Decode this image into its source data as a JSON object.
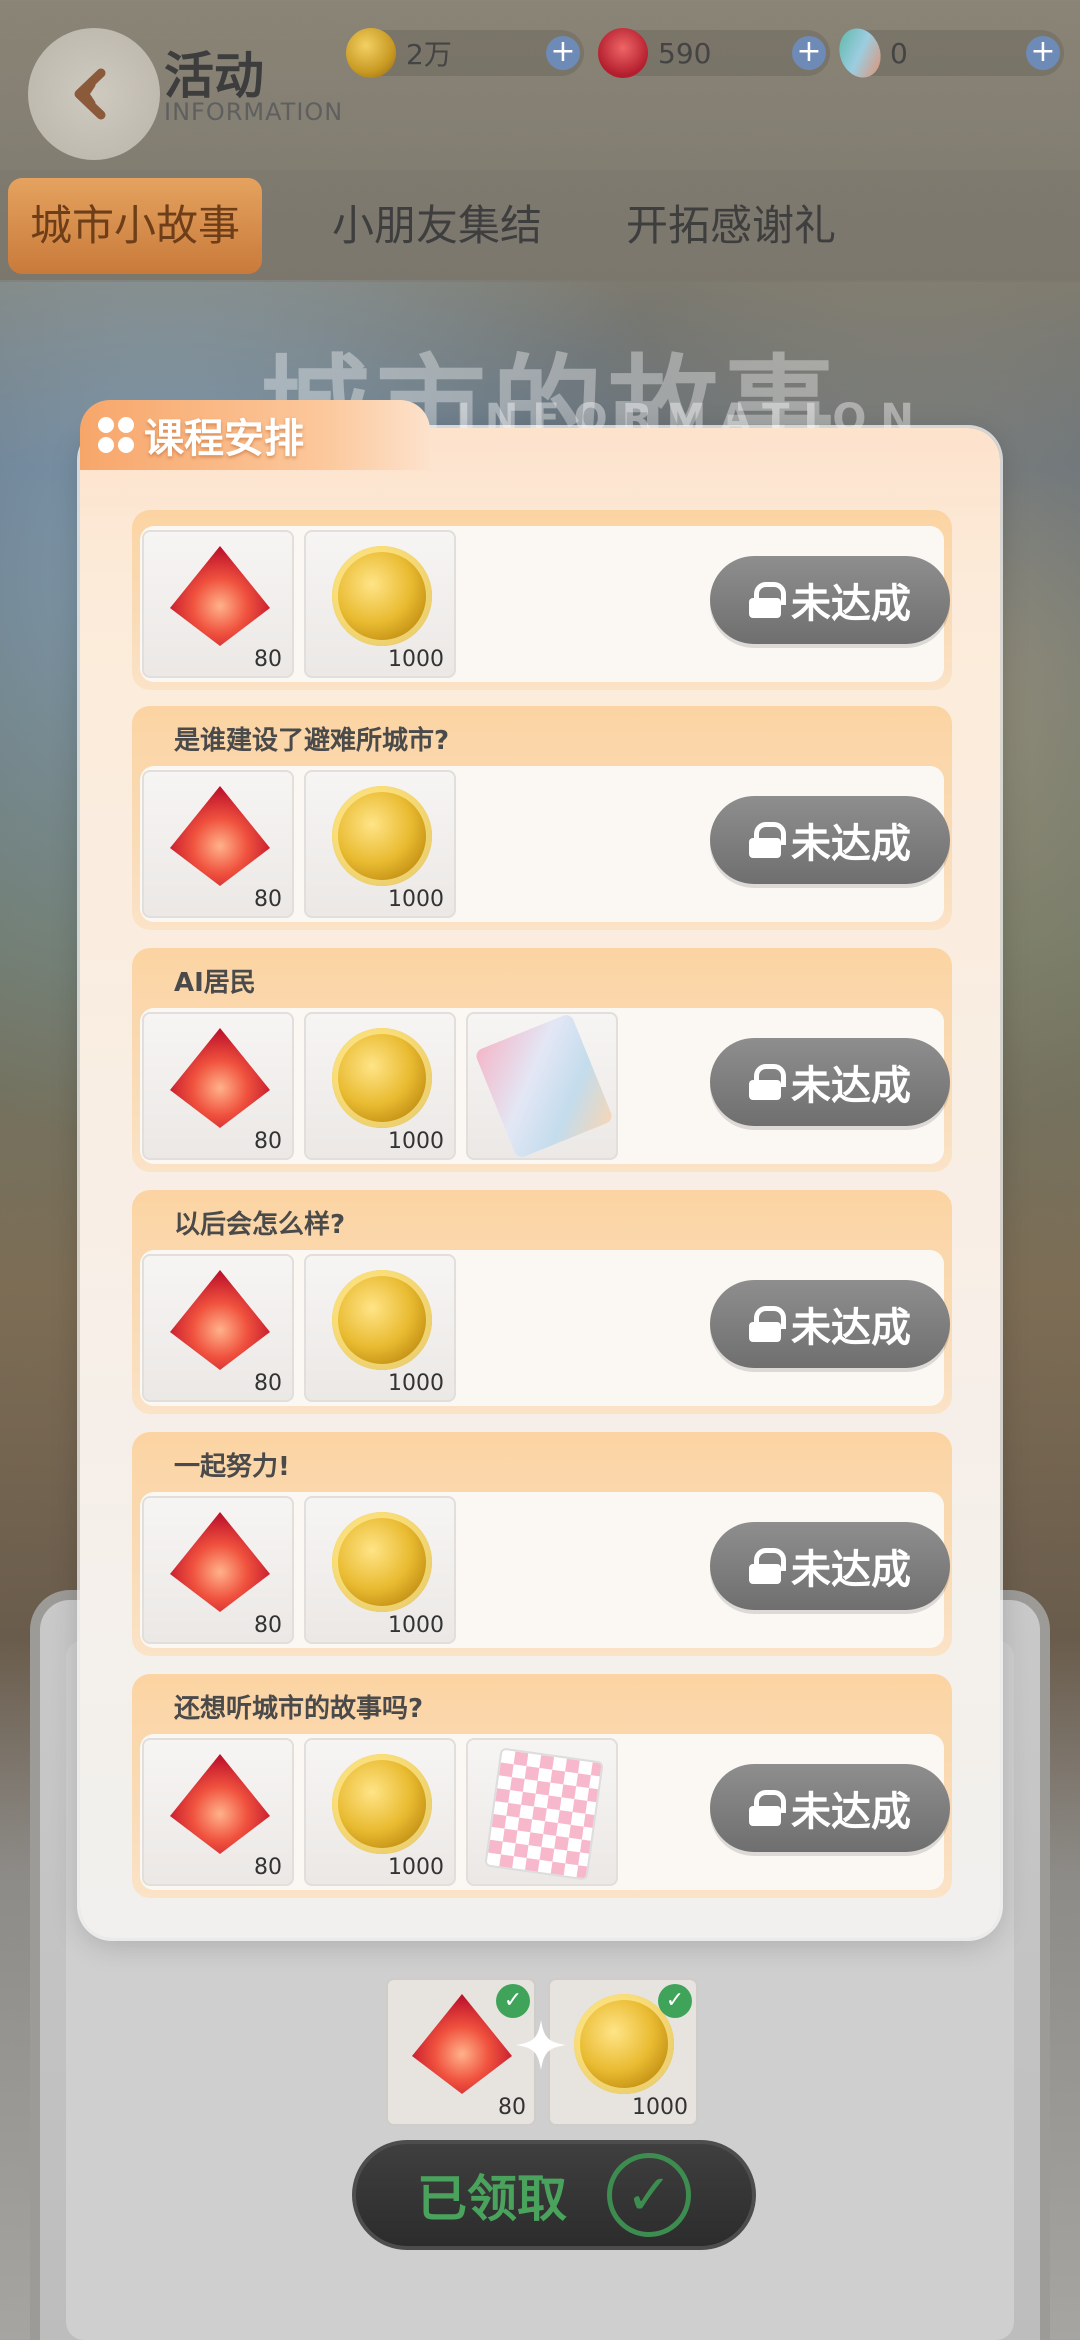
{
  "header": {
    "title": "活动",
    "subtitle": "INFORMATION",
    "currencies": [
      {
        "icon": "coin-icon",
        "value": "2万"
      },
      {
        "icon": "gem-icon",
        "value": "590"
      },
      {
        "icon": "card-icon",
        "value": "0"
      }
    ],
    "plus": "+"
  },
  "tabs": [
    {
      "label": "城市小故事",
      "active": true
    },
    {
      "label": "小朋友集结",
      "active": false
    },
    {
      "label": "开拓感谢礼",
      "active": false
    }
  ],
  "background": {
    "title": "城市的故事",
    "subtitle": "INFORMATION"
  },
  "panel": {
    "title": "课程安排",
    "tasks": [
      {
        "title": "",
        "rewards": [
          {
            "icon": "gem-icon",
            "qty": "80"
          },
          {
            "icon": "coin-icon",
            "qty": "1000"
          }
        ],
        "status": "未达成"
      },
      {
        "title": "是谁建设了避难所城市?",
        "rewards": [
          {
            "icon": "gem-icon",
            "qty": "80"
          },
          {
            "icon": "coin-icon",
            "qty": "1000"
          }
        ],
        "status": "未达成"
      },
      {
        "title": "AI居民",
        "rewards": [
          {
            "icon": "gem-icon",
            "qty": "80"
          },
          {
            "icon": "coin-icon",
            "qty": "1000"
          },
          {
            "icon": "ticket-card-icon",
            "qty": ""
          }
        ],
        "status": "未达成"
      },
      {
        "title": "以后会怎么样?",
        "rewards": [
          {
            "icon": "gem-icon",
            "qty": "80"
          },
          {
            "icon": "coin-icon",
            "qty": "1000"
          }
        ],
        "status": "未达成"
      },
      {
        "title": "一起努力!",
        "rewards": [
          {
            "icon": "gem-icon",
            "qty": "80"
          },
          {
            "icon": "coin-icon",
            "qty": "1000"
          }
        ],
        "status": "未达成"
      },
      {
        "title": "还想听城市的故事吗?",
        "rewards": [
          {
            "icon": "gem-icon",
            "qty": "80"
          },
          {
            "icon": "coin-icon",
            "qty": "1000"
          },
          {
            "icon": "checkered-card-icon",
            "qty": ""
          }
        ],
        "status": "未达成"
      }
    ]
  },
  "claimed_rewards": [
    {
      "icon": "gem-icon",
      "qty": "80"
    },
    {
      "icon": "coin-icon",
      "qty": "1000"
    }
  ],
  "claimed_button": {
    "label": "已领取",
    "icon": "check-icon"
  }
}
